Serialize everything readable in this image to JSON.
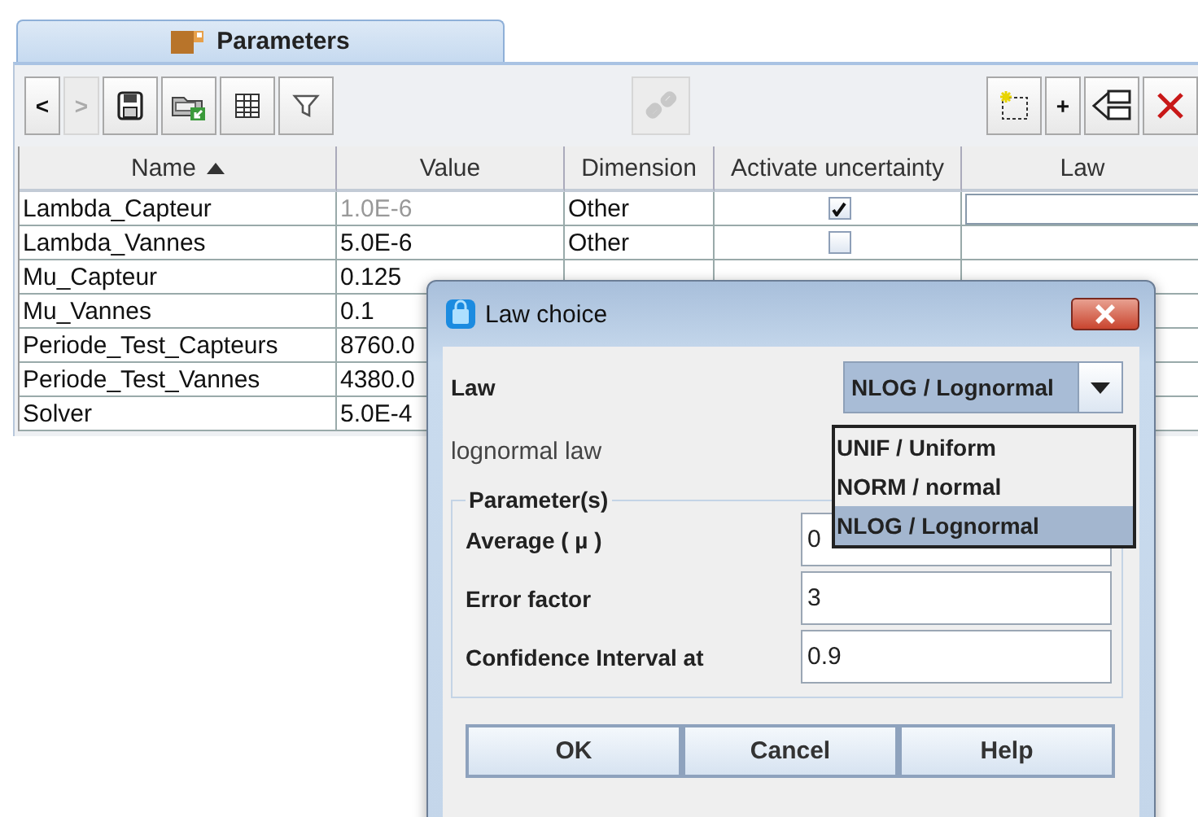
{
  "tab": {
    "label": "Parameters",
    "selected": true
  },
  "toolbar": {
    "left": [
      {
        "kind": "text",
        "label": "<",
        "disabled": false
      },
      {
        "kind": "text",
        "label": ">",
        "disabled": true
      },
      {
        "kind": "save",
        "disabled": false
      },
      {
        "kind": "import",
        "disabled": false
      },
      {
        "kind": "table",
        "disabled": false
      },
      {
        "kind": "filter",
        "disabled": false
      }
    ],
    "middle": [
      {
        "kind": "link",
        "disabled": true
      }
    ],
    "right": [
      {
        "kind": "new",
        "disabled": false
      },
      {
        "kind": "text",
        "label": "+",
        "disabled": false
      },
      {
        "kind": "tree",
        "disabled": false
      },
      {
        "kind": "delete",
        "disabled": false
      }
    ]
  },
  "table": {
    "columns": [
      {
        "label": "Name",
        "sorted": true
      },
      {
        "label": "Value",
        "sorted": false
      },
      {
        "label": "Dimension",
        "sorted": false
      },
      {
        "label": "Activate uncertainty",
        "sorted": false
      },
      {
        "label": "Law",
        "sorted": false
      }
    ],
    "rows": [
      {
        "name": "Lambda_Capteur",
        "value": "1.0E-6",
        "dimmed": true,
        "dimension": "Other",
        "uncertainty": true,
        "law_editing": true
      },
      {
        "name": "Lambda_Vannes",
        "value": "5.0E-6",
        "dimmed": false,
        "dimension": "Other",
        "uncertainty": false,
        "law_editing": false
      },
      {
        "name": "Mu_Capteur",
        "value": "0.125",
        "dimmed": false,
        "law_editing": false
      },
      {
        "name": "Mu_Vannes",
        "value": "0.1",
        "dimmed": false,
        "law_editing": false
      },
      {
        "name": "Periode_Test_Capteurs",
        "value": "8760.0",
        "dimmed": false,
        "law_editing": false
      },
      {
        "name": "Periode_Test_Vannes",
        "value": "4380.0",
        "dimmed": false,
        "law_editing": false
      },
      {
        "name": "Solver",
        "value": "5.0E-4",
        "dimmed": false,
        "law_editing": false
      }
    ]
  },
  "dialog": {
    "title": "Law choice",
    "law_label": "Law",
    "law_value": "NLOG / Lognormal",
    "description": "lognormal law",
    "group_title": "Parameter(s)",
    "params": [
      {
        "label": "Average ( µ )",
        "value": "0"
      },
      {
        "label": "Error factor",
        "value": "3"
      },
      {
        "label": "Confidence Interval at",
        "value": "0.9"
      }
    ],
    "dropdown": [
      {
        "label": "UNIF / Uniform",
        "selected": false
      },
      {
        "label": "NORM / normal",
        "selected": false
      },
      {
        "label": "NLOG / Lognormal",
        "selected": true
      }
    ],
    "buttons": [
      "OK",
      "Cancel",
      "Help"
    ]
  }
}
